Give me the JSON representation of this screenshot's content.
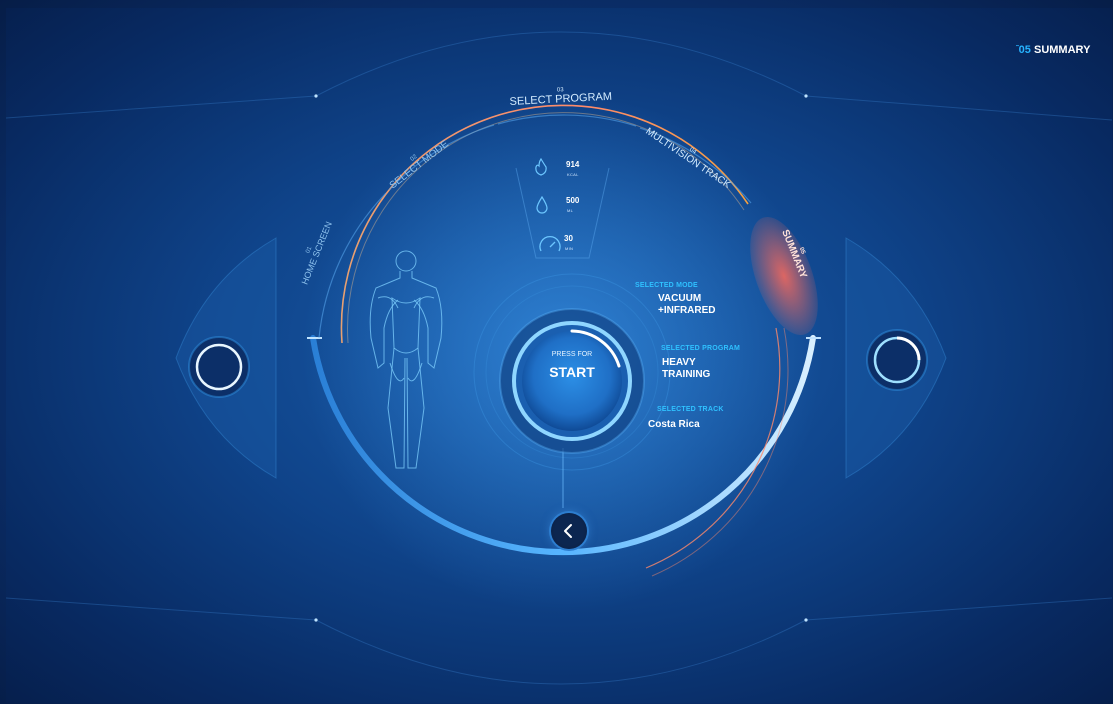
{
  "header": {
    "badge_num": "05",
    "badge_label": "SUMMARY"
  },
  "steps": [
    {
      "num": "01",
      "label": "HOME SCREEN"
    },
    {
      "num": "02",
      "label": "SELECT MODE"
    },
    {
      "num": "03",
      "label": "SELECT PROGRAM"
    },
    {
      "num": "04",
      "label": "MULTIVISION TRACK"
    },
    {
      "num": "05",
      "label": "SUMMARY"
    }
  ],
  "stats": {
    "calories": {
      "value": "914",
      "unit": "KCAL",
      "icon": "flame-icon"
    },
    "water": {
      "value": "500",
      "unit": "ML",
      "icon": "water-drop-icon"
    },
    "duration": {
      "value": "30",
      "unit": "MIN",
      "icon": "speedometer-icon"
    }
  },
  "start": {
    "press_label": "PRESS FOR",
    "main_label": "START"
  },
  "summary": {
    "mode_label": "SELECTED MODE",
    "mode_value_1": "VACUUM",
    "mode_value_2": "+INFRARED",
    "program_label": "SELECTED PROGRAM",
    "program_value_1": "HEAVY",
    "program_value_2": "TRAINING",
    "track_label": "SELECTED TRACK",
    "track_value": "Costa Rica"
  },
  "colors": {
    "accent_cyan": "#2fc1ff",
    "active_step": "#ff6a5a",
    "progress_orange": "#f0a050"
  }
}
